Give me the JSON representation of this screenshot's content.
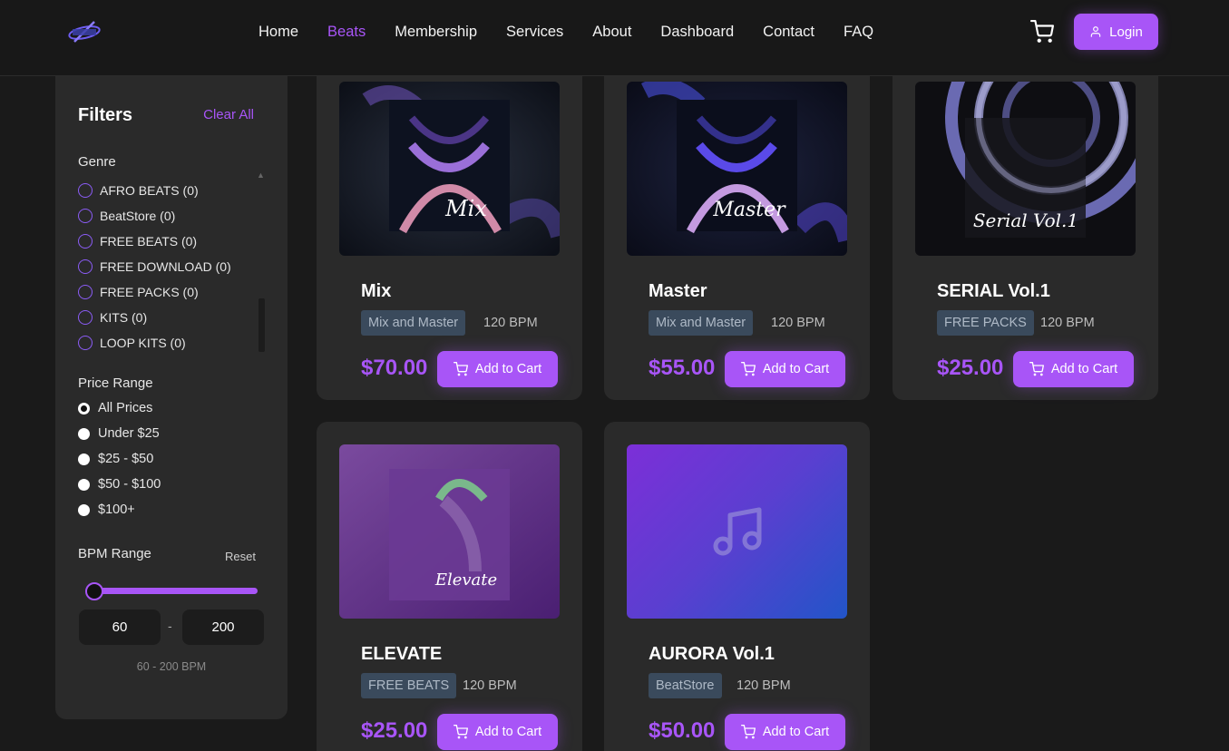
{
  "header": {
    "nav": [
      "Home",
      "Beats",
      "Membership",
      "Services",
      "About",
      "Dashboard",
      "Contact",
      "FAQ"
    ],
    "active_nav": "Beats",
    "login_label": "Login"
  },
  "filters": {
    "title": "Filters",
    "clear_all": "Clear All",
    "genre_label": "Genre",
    "genres": [
      "AFRO BEATS (0)",
      "BeatStore (0)",
      "FREE BEATS (0)",
      "FREE DOWNLOAD (0)",
      "FREE PACKS (0)",
      "KITS (0)",
      "LOOP KITS (0)"
    ],
    "price_label": "Price Range",
    "prices": [
      "All Prices",
      "Under $25",
      "$25 - $50",
      "$50 - $100",
      "$100+"
    ],
    "selected_price": "All Prices",
    "bpm_label": "BPM Range",
    "reset_label": "Reset",
    "bpm_min": "60",
    "bpm_max": "200",
    "bpm_dash": "-",
    "bpm_range_text": "60 - 200 BPM"
  },
  "cards": [
    {
      "title": "Mix",
      "tag": "Mix and Master",
      "bpm": "120 BPM",
      "price": "$70.00",
      "button": "Add to Cart",
      "cover_script": "Mix"
    },
    {
      "title": "Master",
      "tag": "Mix and Master",
      "bpm": "120 BPM",
      "price": "$55.00",
      "button": "Add to Cart",
      "cover_script": "Master"
    },
    {
      "title": "SERIAL Vol.1",
      "tag": "FREE PACKS",
      "bpm": "120 BPM",
      "price": "$25.00",
      "button": "Add to Cart",
      "cover_script": "Serial Vol.1"
    },
    {
      "title": "ELEVATE",
      "tag": "FREE BEATS",
      "bpm": "120 BPM",
      "price": "$25.00",
      "button": "Add to Cart",
      "cover_script": "Elevate"
    },
    {
      "title": "AURORA Vol.1",
      "tag": "BeatStore",
      "bpm": "120 BPM",
      "price": "$50.00",
      "button": "Add to Cart",
      "cover_script": ""
    }
  ],
  "colors": {
    "accent": "#a855f7",
    "background": "#1a1a1a",
    "card": "#2a2a2a",
    "tag_bg": "#3a4a5c"
  }
}
